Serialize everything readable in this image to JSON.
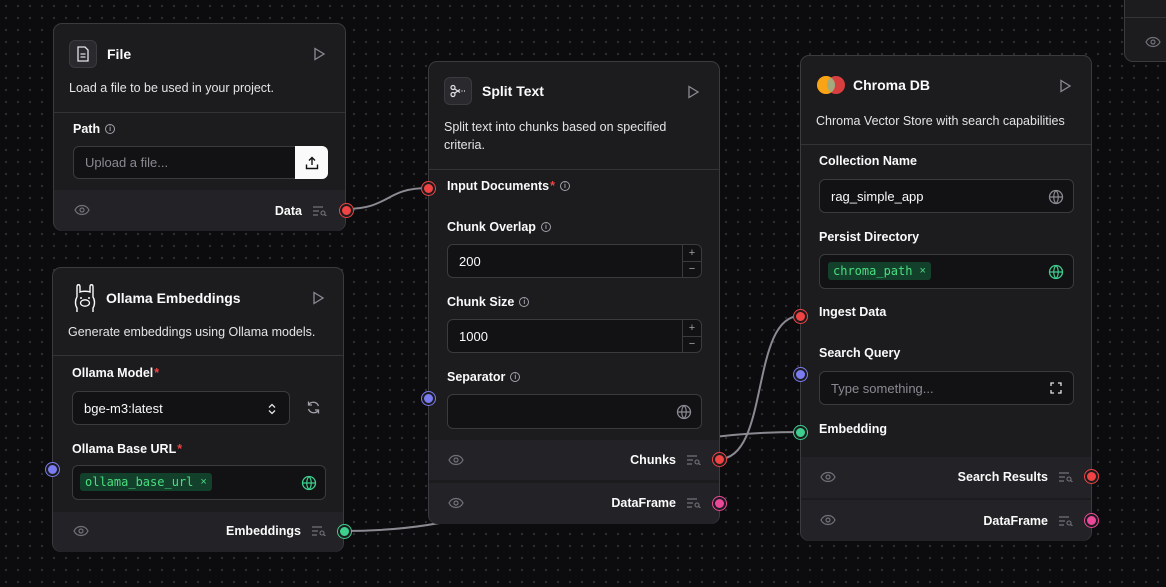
{
  "file_node": {
    "title": "File",
    "description": "Load a file to be used in your project.",
    "path_label": "Path",
    "path_placeholder": "Upload a file...",
    "output_label": "Data"
  },
  "ollama_node": {
    "title": "Ollama Embeddings",
    "description": "Generate embeddings using Ollama models.",
    "model_label": "Ollama Model",
    "model_value": "bge-m3:latest",
    "base_url_label": "Ollama Base URL",
    "base_url_value": "ollama_base_url",
    "output_label": "Embeddings"
  },
  "split_node": {
    "title": "Split Text",
    "description_line1": "Split text into chunks based on specified",
    "description_line2": "criteria.",
    "input_docs_label": "Input Documents",
    "chunk_overlap_label": "Chunk Overlap",
    "chunk_overlap_value": "200",
    "chunk_size_label": "Chunk Size",
    "chunk_size_value": "1000",
    "separator_label": "Separator",
    "separator_value": "",
    "output_chunks": "Chunks",
    "output_dataframe": "DataFrame"
  },
  "chroma_node": {
    "title": "Chroma DB",
    "description": "Chroma Vector Store with search capabilities",
    "collection_label": "Collection Name",
    "collection_value": "rag_simple_app",
    "persist_label": "Persist Directory",
    "persist_value": "chroma_path",
    "ingest_label": "Ingest Data",
    "search_query_label": "Search Query",
    "search_query_placeholder": "Type something...",
    "embedding_label": "Embedding",
    "output_search": "Search Results",
    "output_dataframe": "DataFrame"
  },
  "colors": {
    "handle_red": "#f04444",
    "handle_blue": "#7b7cf0",
    "handle_green": "#3ecf8e",
    "handle_pink": "#ec4899",
    "badge_green": "#4ade80"
  },
  "icons": [
    "file-icon",
    "scissors-icon",
    "chroma-logo-icon",
    "llama-icon",
    "play-icon",
    "eye-icon",
    "list-search-icon",
    "upload-icon",
    "globe-icon",
    "refresh-icon",
    "chevron-updown-icon",
    "expand-icon",
    "info-icon"
  ]
}
